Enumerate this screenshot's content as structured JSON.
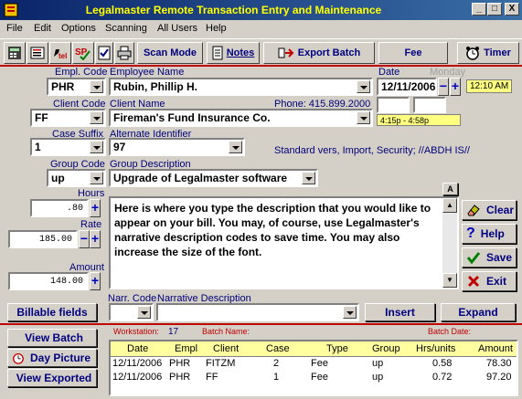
{
  "window": {
    "title": "Legalmaster Remote Transaction Entry and Maintenance",
    "min_label": "_",
    "max_label": "□",
    "close_label": "X"
  },
  "menu": [
    "File",
    "Edit",
    "Options",
    "Scanning",
    "All Users",
    "Help"
  ],
  "toolbar": {
    "scan_mode": "Scan Mode",
    "notes": "Notes",
    "export_batch": "Export Batch",
    "fee": "Fee",
    "timer": "Timer"
  },
  "form": {
    "empl_code_label": "Empl. Code",
    "empl_code": "PHR",
    "employee_name_label": "Employee Name",
    "employee_name": "Rubin, Phillip H.",
    "date_label": "Date",
    "weekday": "Monday",
    "date": "12/11/2006",
    "time": "12:10 AM",
    "time_range": "4:15p  -  4:58p",
    "client_code_label": "Client Code",
    "client_code": "FF",
    "client_name_label": "Client Name",
    "phone": "Phone: 415.899.2000",
    "client_name": "Fireman's Fund Insurance Co.",
    "case_suffix_label": "Case Suffix",
    "case_suffix": "1",
    "alt_id_label": "Alternate Identifier",
    "alt_id": "97",
    "standard_info": "Standard vers, Import, Security; //ABDH IS//",
    "group_code_label": "Group Code",
    "group_code": "up",
    "group_desc_label": "Group Description",
    "group_desc": "Upgrade of Legalmaster software",
    "hours_label": "Hours",
    "hours": ".80",
    "rate_label": "Rate",
    "rate": "185.00",
    "amount_label": "Amount",
    "amount": "148.00",
    "description": "Here is where you type the description that you would like to appear on your bill.  You may, of course, use Legalmaster's narrative description codes to save time.  You may also increase the size of the font.",
    "font_icon_label": "A"
  },
  "actions": {
    "clear": "Clear",
    "help": "Help",
    "save": "Save",
    "exit": "Exit",
    "billable_fields": "Billable fields",
    "narr_code_label": "Narr. Code",
    "narr_desc_label": "Narrative Description",
    "insert": "Insert",
    "expand": "Expand"
  },
  "bottom": {
    "view_batch": "View Batch",
    "day_picture": "Day Picture",
    "view_exported": "View Exported",
    "workstation_label": "Workstation:",
    "workstation": "17",
    "batch_name_label": "Batch Name:",
    "batch_date_label": "Batch Date:",
    "columns": [
      "Date",
      "Empl",
      "Client",
      "Case",
      "Type",
      "Group",
      "Hrs/units",
      "Amount"
    ],
    "rows": [
      [
        "12/11/2006",
        "PHR",
        "FITZM",
        "2",
        "Fee",
        "up",
        "0.58",
        "78.30"
      ],
      [
        "12/11/2006",
        "PHR",
        "FF",
        "1",
        "Fee",
        "up",
        "0.72",
        "97.20"
      ]
    ]
  }
}
